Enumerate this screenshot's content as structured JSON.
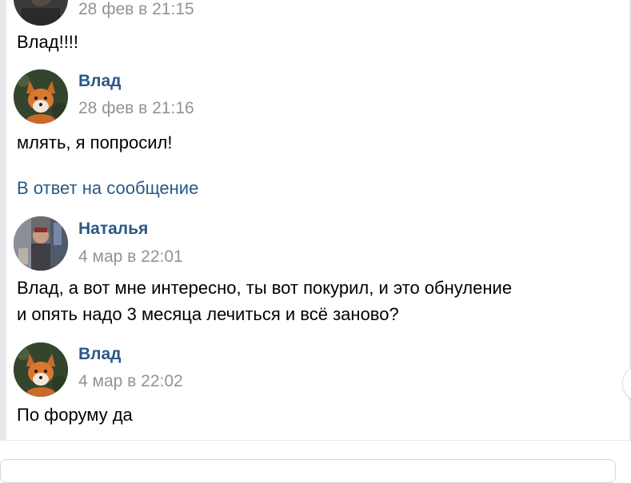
{
  "messages": [
    {
      "author": "",
      "date": "28 фев в 21:15",
      "text_lines": [
        "Влад!!!!"
      ]
    },
    {
      "author": "Влад",
      "date": "28 фев в 21:16",
      "text_lines": [
        "млять, я попросил!"
      ],
      "reply_link": "В ответ на сообщение"
    },
    {
      "author": "Наталья",
      "date": "4 мар в 22:01",
      "text_lines": [
        "Влад, а вот мне интересно, ты вот покурил, и это обнуление",
        "и опять надо 3 месяца лечиться и всё заново?"
      ]
    },
    {
      "author": "Влад",
      "date": "4 мар в 22:02",
      "text_lines": [
        "По форуму да"
      ]
    }
  ],
  "avatars": {
    "fox": "fox-avatar",
    "person": "person-avatar"
  },
  "colors": {
    "link": "#2a5885",
    "date": "#939393",
    "border": "#e7e8ec"
  }
}
